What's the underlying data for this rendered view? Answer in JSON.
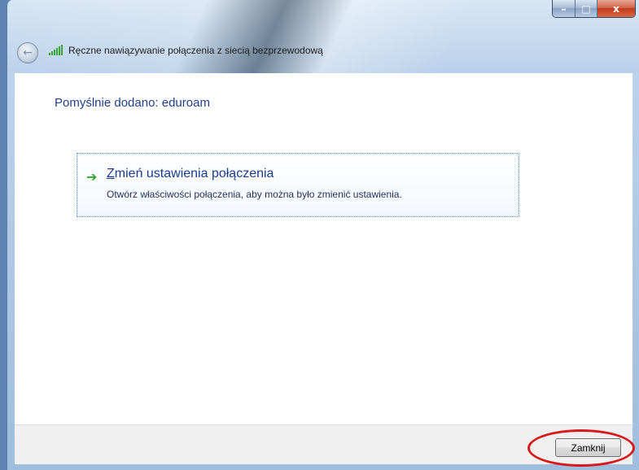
{
  "window": {
    "title": "Ręczne nawiązywanie połączenia z siecią bezprzewodową",
    "controls": {
      "minimize": "–",
      "maximize": "□",
      "close": "x"
    }
  },
  "content": {
    "heading": "Pomyślnie dodano: eduroam",
    "option": {
      "title_accel": "Z",
      "title_rest": "mień ustawienia połączenia",
      "description": "Otwórz właściwości połączenia, aby można było zmienić ustawienia."
    }
  },
  "footer": {
    "close_label": "Zamknij"
  },
  "colors": {
    "heading": "#1f3f8c",
    "arrow": "#2fa52f",
    "annotation": "#d7191c"
  },
  "icons": [
    "back-arrow-icon",
    "wireless-signal-icon",
    "green-arrow-icon"
  ]
}
